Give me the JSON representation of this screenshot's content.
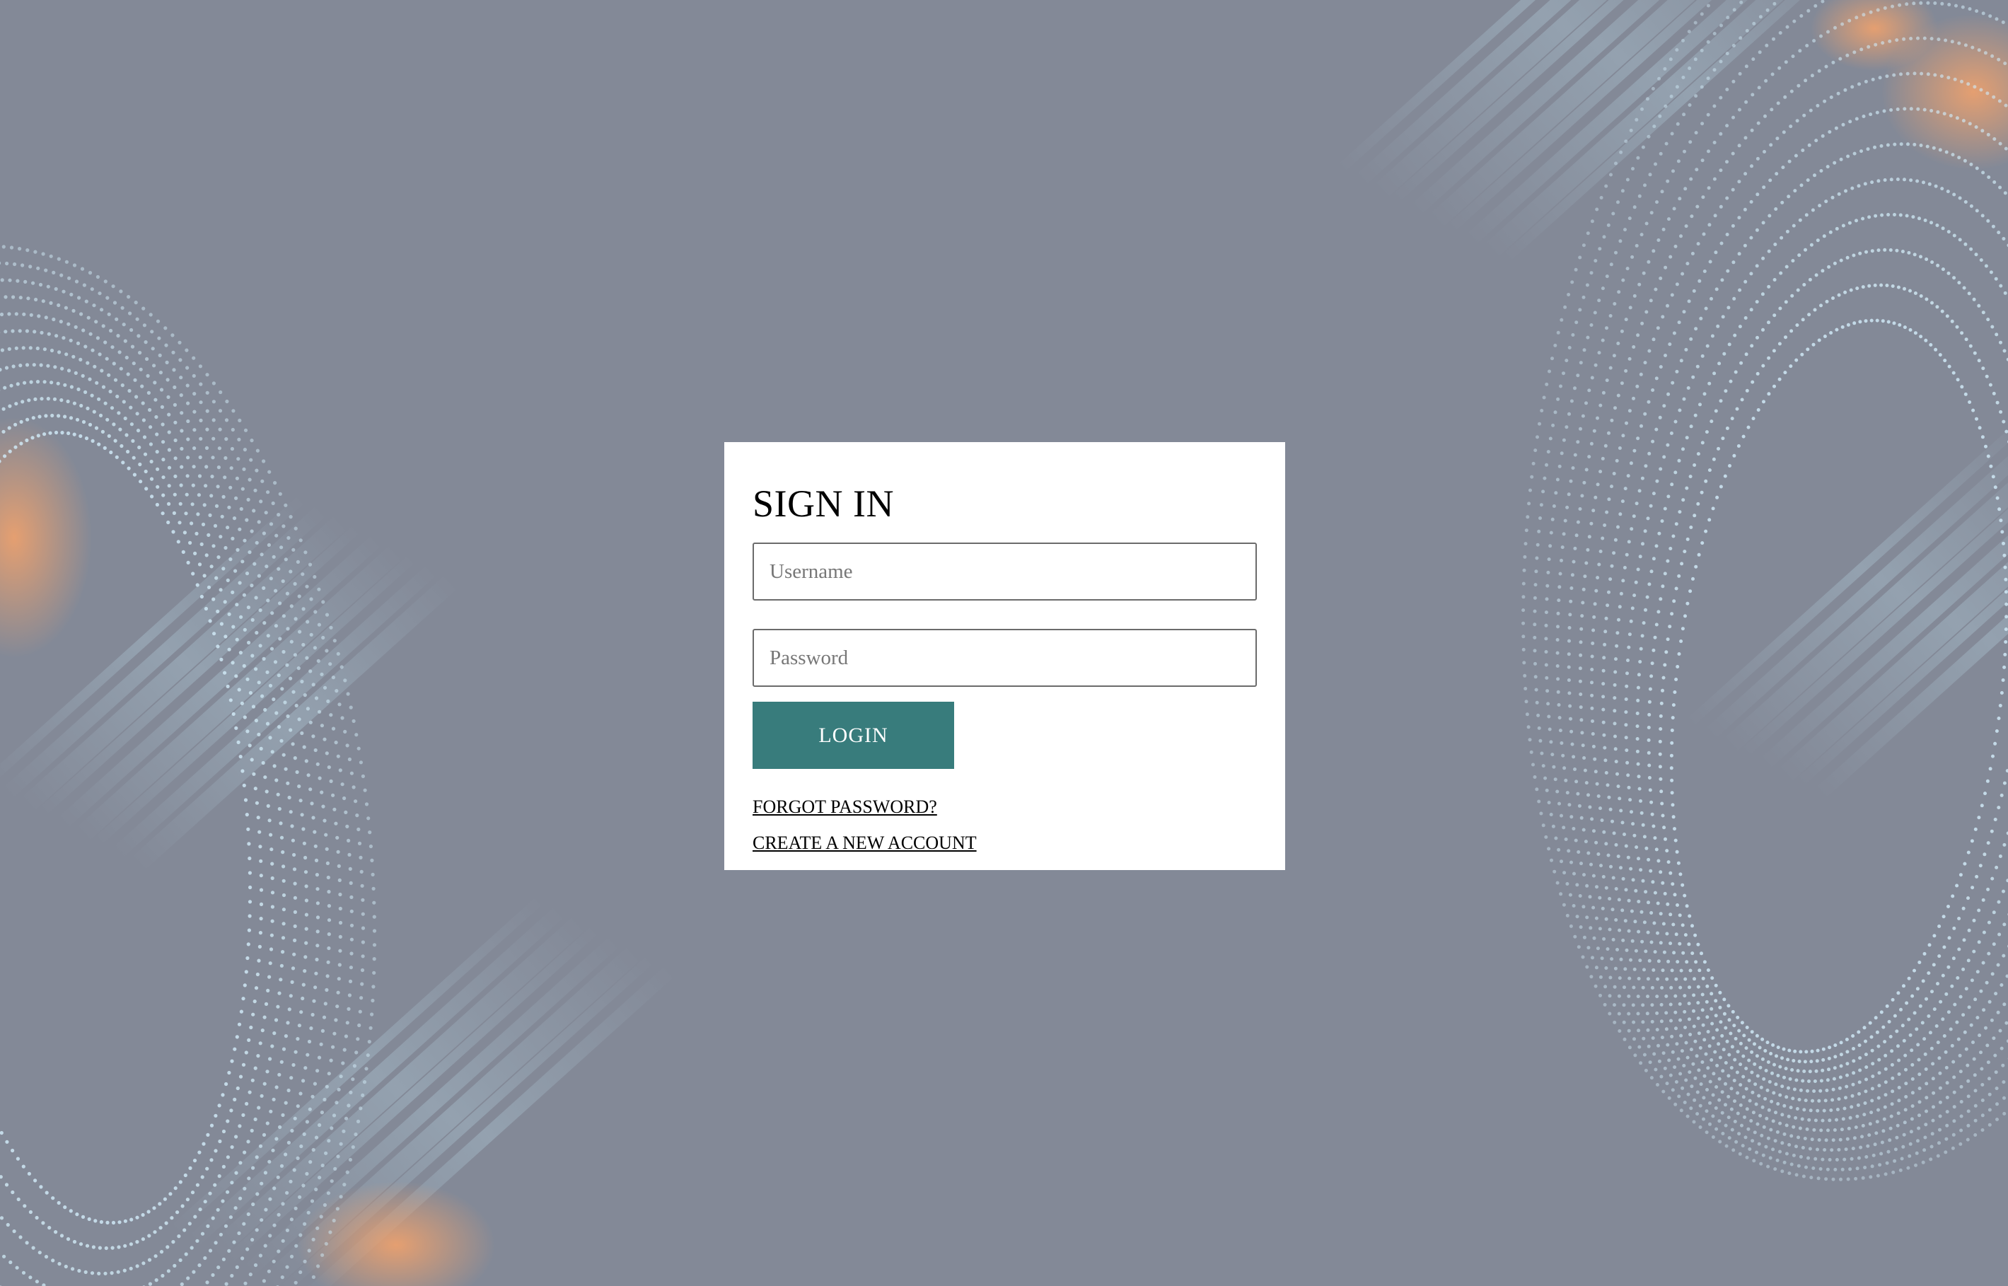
{
  "colors": {
    "background": "#838997",
    "card": "#ffffff",
    "accent": "#387c7c",
    "dot": "#cfe8f4",
    "glow": "#f0a070"
  },
  "signin": {
    "title": "SIGN IN",
    "username_placeholder": "Username",
    "username_value": "",
    "password_placeholder": "Password",
    "password_value": "",
    "login_label": "LOGIN",
    "forgot_label": "FORGOT PASSWORD?",
    "create_label": "CREATE A NEW ACCOUNT"
  }
}
